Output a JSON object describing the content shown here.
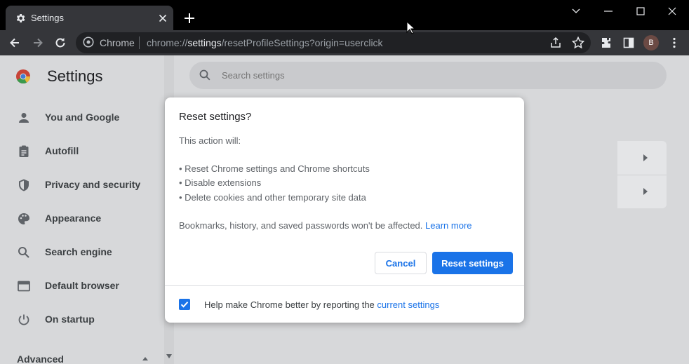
{
  "browser": {
    "tab_title": "Settings",
    "site_label": "Chrome",
    "url_scheme": "chrome://",
    "url_host": "settings",
    "url_path": "/resetProfileSettings?origin=userclick",
    "avatar_letter": "B"
  },
  "settings": {
    "title": "Settings",
    "search_placeholder": "Search settings",
    "nav": [
      {
        "label": "You and Google",
        "icon": "person-icon"
      },
      {
        "label": "Autofill",
        "icon": "clipboard-icon"
      },
      {
        "label": "Privacy and security",
        "icon": "shield-icon"
      },
      {
        "label": "Appearance",
        "icon": "palette-icon"
      },
      {
        "label": "Search engine",
        "icon": "search-icon"
      },
      {
        "label": "Default browser",
        "icon": "browser-window-icon"
      },
      {
        "label": "On startup",
        "icon": "power-icon"
      }
    ],
    "advanced_label": "Advanced"
  },
  "dialog": {
    "title": "Reset settings?",
    "intro": "This action will:",
    "bullets": [
      "• Reset Chrome settings and Chrome shortcuts",
      "• Disable extensions",
      "• Delete cookies and other temporary site data"
    ],
    "note": "Bookmarks, history, and saved passwords won't be affected.",
    "learn_more": "Learn more",
    "cancel_label": "Cancel",
    "reset_label": "Reset settings",
    "footer_text": "Help make Chrome better by reporting the",
    "footer_link": "current settings",
    "checkbox_checked": true
  },
  "colors": {
    "accent": "#1a73e8",
    "titlebar": "#000000",
    "toolbar": "#35363a"
  }
}
